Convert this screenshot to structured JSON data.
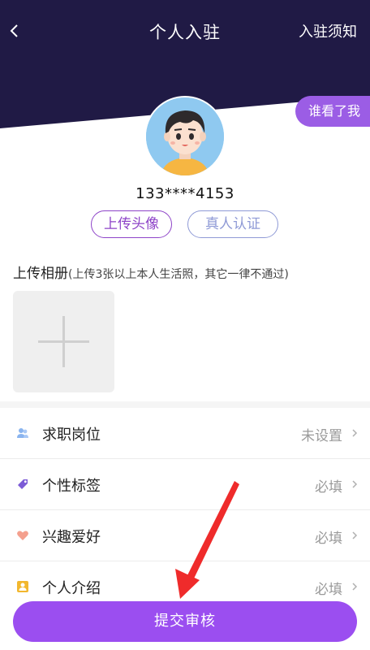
{
  "header": {
    "title": "个人入驻",
    "right_link": "入驻须知",
    "bg_color": "#201a45"
  },
  "who_viewed": "谁看了我",
  "profile": {
    "phone": "133****4153",
    "upload_avatar_label": "上传头像",
    "verify_label": "真人认证"
  },
  "album": {
    "title": "上传相册",
    "hint": "(上传3张以上本人生活照，其它一律不通过)"
  },
  "rows": [
    {
      "label": "求职岗位",
      "value": "未设置",
      "icon": "people-icon"
    },
    {
      "label": "个性标签",
      "value": "必填",
      "icon": "tag-icon"
    },
    {
      "label": "兴趣爱好",
      "value": "必填",
      "icon": "heart-icon"
    },
    {
      "label": "个人介绍",
      "value": "必填",
      "icon": "profile-card-icon"
    }
  ],
  "submit_label": "提交审核",
  "colors": {
    "accent": "#9b4ef0",
    "arrow": "#ef2b2b"
  }
}
